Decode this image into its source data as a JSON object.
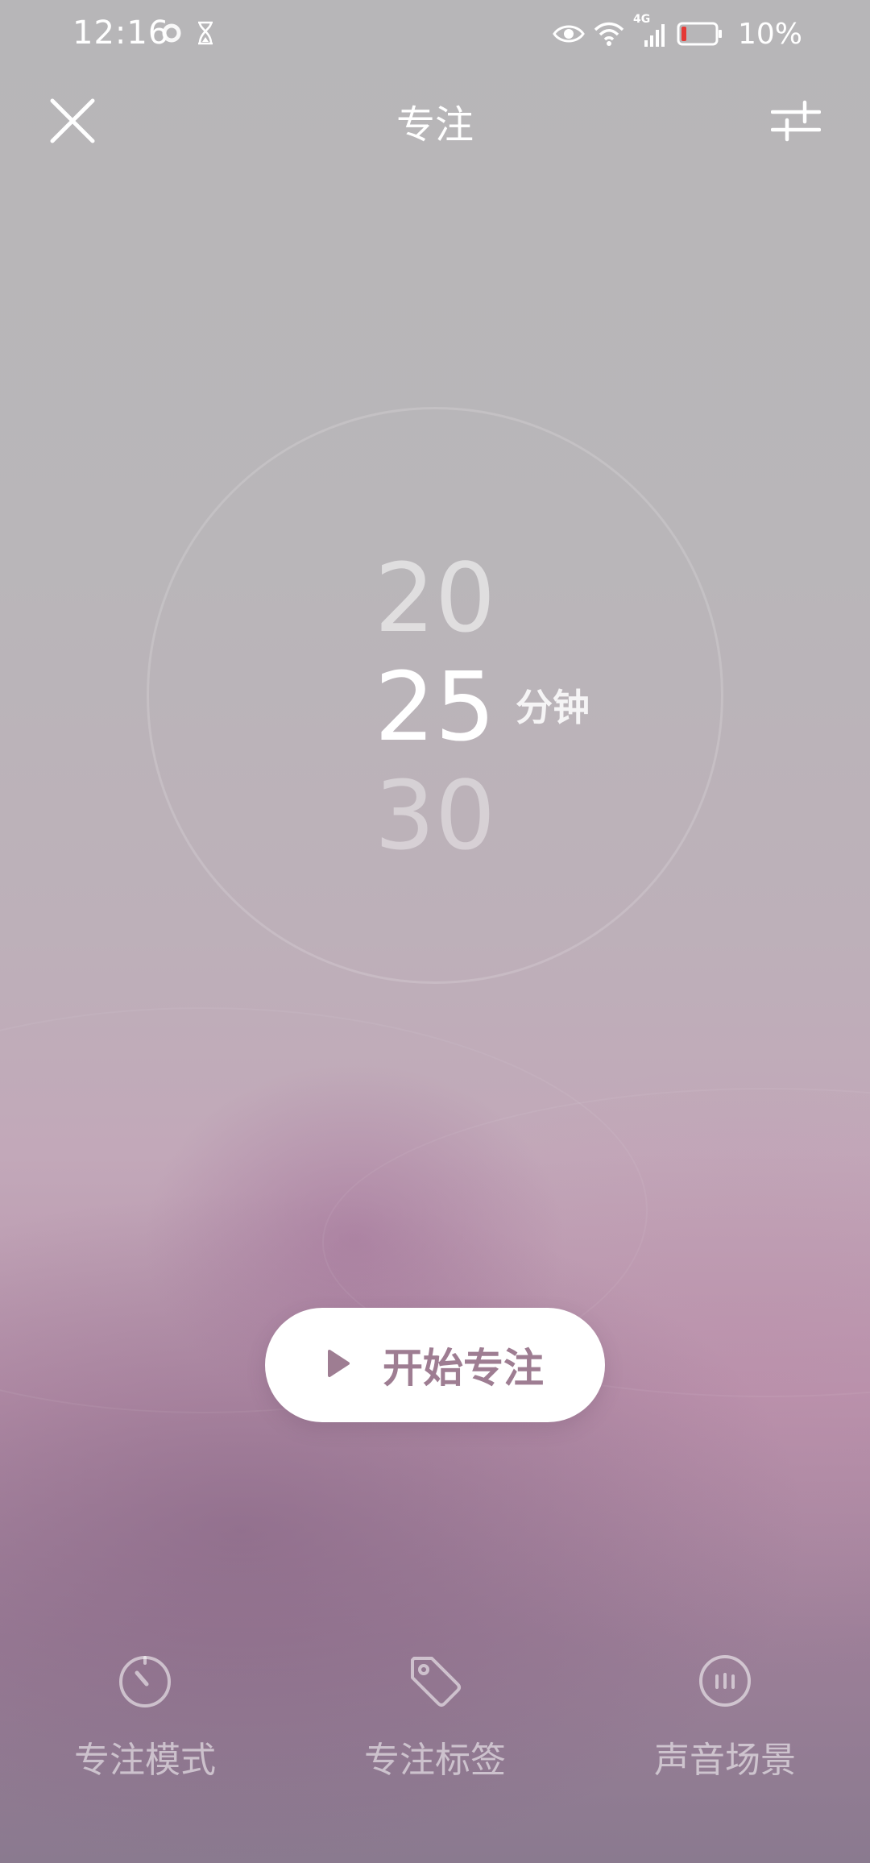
{
  "status_bar": {
    "time": "12:16",
    "battery_percent": "10%",
    "network_label": "4G",
    "icons": [
      "focus-ring-icon",
      "hourglass-icon",
      "eye-icon",
      "wifi-icon",
      "signal-icon",
      "battery-icon"
    ],
    "battery_level": 0.1,
    "battery_color": "#e53935"
  },
  "header": {
    "title": "专注",
    "close_icon": "close-icon",
    "settings_icon": "sliders-icon"
  },
  "timer": {
    "previous_value": "20",
    "current_value": "25",
    "next_value": "30",
    "unit": "分钟"
  },
  "start_button": {
    "label": "开始专注",
    "icon": "play-icon",
    "accent_color": "#9e7d92"
  },
  "bottom_nav": {
    "items": [
      {
        "label": "专注模式",
        "icon": "timer-icon"
      },
      {
        "label": "专注标签",
        "icon": "tag-icon"
      },
      {
        "label": "声音场景",
        "icon": "sound-bars-icon"
      }
    ]
  }
}
